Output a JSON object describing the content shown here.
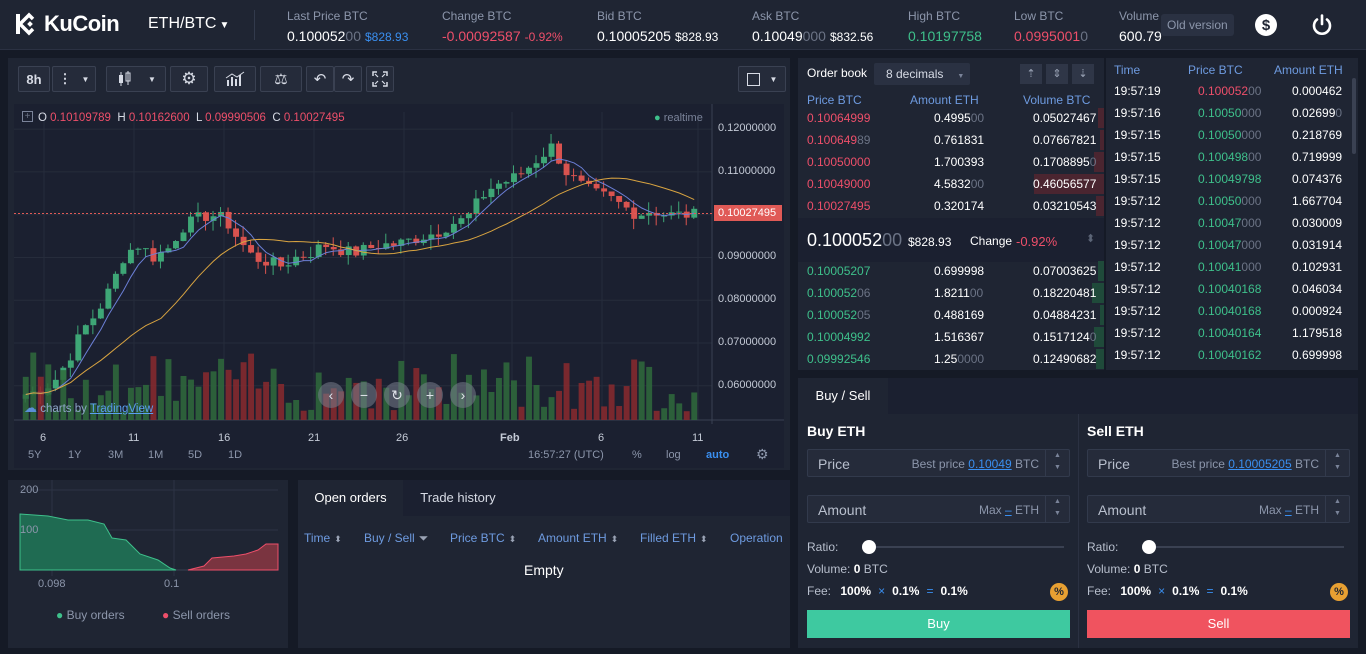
{
  "header": {
    "brand": "KuCoin",
    "pair": "ETH/BTC",
    "old_version": "Old version",
    "tickers": [
      {
        "label": "Last Price BTC",
        "value_main": "0.100052",
        "value_dim": "00",
        "sub": "$828.93"
      },
      {
        "label": "Change BTC",
        "value_main": "-0.00092587",
        "sub": "-0.92%"
      },
      {
        "label": "Bid BTC",
        "value_main": "0.10005205",
        "sub": "$828.93"
      },
      {
        "label": "Ask BTC",
        "value_main": "0.10049",
        "value_dim": "000",
        "sub": "$832.56"
      },
      {
        "label": "High BTC",
        "value_main": "0.10197758"
      },
      {
        "label": "Low BTC",
        "value_main": "0.0995001",
        "value_dim": "0"
      },
      {
        "label": "Volume",
        "value_main": "600.79"
      }
    ]
  },
  "chart_toolbar": {
    "interval": "8h"
  },
  "chart": {
    "ohlc": {
      "o_label": "O",
      "o": "0.10109789",
      "h_label": "H",
      "h": "0.10162600",
      "l_label": "L",
      "l": "0.09990506",
      "c_label": "C",
      "c": "0.10027495"
    },
    "realtime": "realtime",
    "y_ticks": [
      "0.12000000",
      "0.11000000",
      "0.09000000",
      "0.08000000",
      "0.07000000",
      "0.06000000"
    ],
    "current_price_tag": "0.10027495",
    "x_ticks": [
      "6",
      "11",
      "16",
      "21",
      "26",
      "Feb",
      "6",
      "11"
    ],
    "tv_text": "charts by",
    "tv_brand": "TradingView",
    "ranges": [
      "5Y",
      "1Y",
      "3M",
      "1M",
      "5D",
      "1D"
    ],
    "time": "16:57:27 (UTC)",
    "pct": "%",
    "log": "log",
    "auto": "auto"
  },
  "chart_data": {
    "type": "candlestick",
    "title": "",
    "ylim": [
      0.052,
      0.124
    ],
    "x_categories_visible": [
      "6",
      "11",
      "16",
      "21",
      "26",
      "Feb",
      "6",
      "11"
    ],
    "last_close": 0.10027495
  },
  "orderbook": {
    "title": "Order book",
    "decimals": "8 decimals",
    "headers": [
      "Price BTC",
      "Amount ETH",
      "Volume BTC"
    ],
    "asks": [
      {
        "price": "0.10064999",
        "amount": "0.4995",
        "amount_dim": "00",
        "volume": "0.05027467"
      },
      {
        "price": "0.100649",
        "price_dim": "89",
        "amount": "0.761831",
        "volume": "0.07667821"
      },
      {
        "price": "0.10050000",
        "amount": "1.700393",
        "volume": "0.1708895",
        "volume_dim": "0"
      },
      {
        "price": "0.10049000",
        "amount": "4.5832",
        "amount_dim": "00",
        "volume": "0.46056577"
      },
      {
        "price": "0.10027495",
        "amount": "0.320174",
        "volume": "0.03210543"
      }
    ],
    "last": "0.100052",
    "last_dim": "00",
    "last_usd": "$828.93",
    "change_label": "Change",
    "change": "-0.92%",
    "bids": [
      {
        "price": "0.10005207",
        "amount": "0.699998",
        "volume": "0.07003625"
      },
      {
        "price": "0.100052",
        "price_dim": "06",
        "amount": "1.8211",
        "amount_dim": "00",
        "volume": "0.18220481"
      },
      {
        "price": "0.100052",
        "price_dim": "05",
        "amount": "0.488169",
        "volume": "0.04884231"
      },
      {
        "price": "0.10004992",
        "amount": "1.516367",
        "volume": "0.1517124",
        "volume_dim": "0"
      },
      {
        "price": "0.09992546",
        "amount": "1.25",
        "amount_dim": "0000",
        "volume": "0.12490682"
      }
    ]
  },
  "trades": {
    "headers": [
      "Time",
      "Price BTC",
      "Amount ETH"
    ],
    "rows": [
      {
        "time": "19:57:19",
        "price": "0.100052",
        "price_dim": "00",
        "side": "sell",
        "amount": "0.000462"
      },
      {
        "time": "19:57:16",
        "price": "0.10050",
        "price_dim": "000",
        "side": "buy",
        "amount": "0.02699",
        "amount_dim": "0"
      },
      {
        "time": "19:57:15",
        "price": "0.10050",
        "price_dim": "000",
        "side": "buy",
        "amount": "0.218769"
      },
      {
        "time": "19:57:15",
        "price": "0.100498",
        "price_dim": "00",
        "side": "buy",
        "amount": "0.719999"
      },
      {
        "time": "19:57:15",
        "price": "0.10049798",
        "side": "buy",
        "amount": "0.074376"
      },
      {
        "time": "19:57:12",
        "price": "0.10050",
        "price_dim": "000",
        "side": "buy",
        "amount": "1.667704"
      },
      {
        "time": "19:57:12",
        "price": "0.10047",
        "price_dim": "000",
        "side": "buy",
        "amount": "0.030009"
      },
      {
        "time": "19:57:12",
        "price": "0.10047",
        "price_dim": "000",
        "side": "buy",
        "amount": "0.031914"
      },
      {
        "time": "19:57:12",
        "price": "0.10041",
        "price_dim": "000",
        "side": "buy",
        "amount": "0.102931"
      },
      {
        "time": "19:57:12",
        "price": "0.10040168",
        "side": "buy",
        "amount": "0.046034"
      },
      {
        "time": "19:57:12",
        "price": "0.10040168",
        "side": "buy",
        "amount": "0.000924"
      },
      {
        "time": "19:57:12",
        "price": "0.10040164",
        "side": "buy",
        "amount": "1.179518"
      },
      {
        "time": "19:57:12",
        "price": "0.10040162",
        "side": "buy",
        "amount": "0.699998"
      }
    ]
  },
  "buysell": {
    "tab": "Buy / Sell",
    "buy": {
      "title": "Buy ETH",
      "price_label": "Price",
      "price_hint": "Best price",
      "price_link": "0.10049",
      "price_unit": "BTC",
      "amount_label": "Amount",
      "amount_hint": "Max",
      "amount_link": "–",
      "amount_unit": "ETH",
      "ratio": "Ratio:",
      "volume_label": "Volume:",
      "volume_value": "0",
      "volume_unit": "BTC",
      "fee_label": "Fee:",
      "fee_a": "100%",
      "fee_b": "0.1%",
      "fee_c": "0.1%",
      "button": "Buy"
    },
    "sell": {
      "title": "Sell ETH",
      "price_label": "Price",
      "price_hint": "Best price",
      "price_link": "0.10005205",
      "price_unit": "BTC",
      "amount_label": "Amount",
      "amount_hint": "Max",
      "amount_link": "–",
      "amount_unit": "ETH",
      "ratio": "Ratio:",
      "volume_label": "Volume:",
      "volume_value": "0",
      "volume_unit": "BTC",
      "fee_label": "Fee:",
      "fee_a": "100%",
      "fee_b": "0.1%",
      "fee_c": "0.1%",
      "button": "Sell"
    },
    "fee_ops": [
      "×",
      "="
    ]
  },
  "depth": {
    "y_ticks": [
      "200",
      "100"
    ],
    "x_ticks": [
      "0.098",
      "0.1"
    ],
    "legend_buy": "Buy orders",
    "legend_sell": "Sell orders"
  },
  "orders": {
    "tabs": [
      "Open orders",
      "Trade history"
    ],
    "columns": [
      "Time",
      "Buy / Sell",
      "Price BTC",
      "Amount ETH",
      "Filled ETH",
      "Operation"
    ],
    "empty": "Empty"
  },
  "colors": {
    "green": "#3ec08b",
    "red": "#ee4f6a",
    "blue": "#3a8ff0",
    "bg": "#1f2533"
  }
}
